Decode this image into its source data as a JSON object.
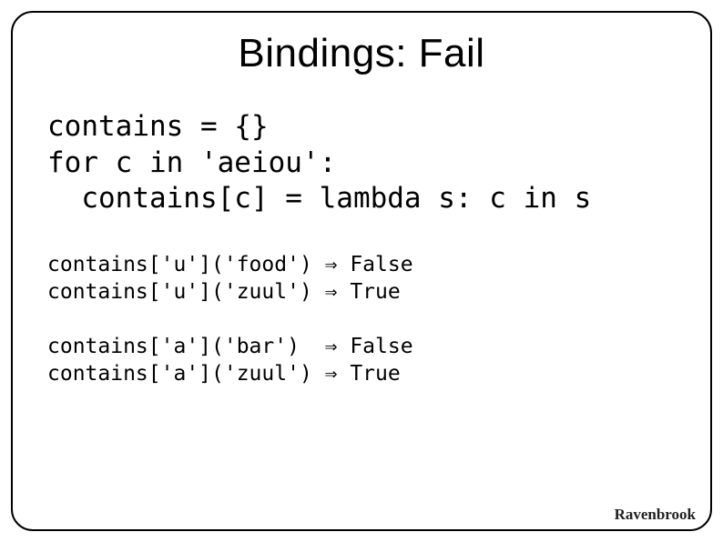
{
  "title": "Bindings: Fail",
  "code_main": "contains = {}\nfor c in 'aeiou':\n  contains[c] = lambda s: c in s",
  "code_output": "contains['u']('food') ⇒ False\ncontains['u']('zuul') ⇒ True\n\ncontains['a']('bar')  ⇒ False\ncontains['a']('zuul') ⇒ True",
  "brand": "Ravenbrook"
}
